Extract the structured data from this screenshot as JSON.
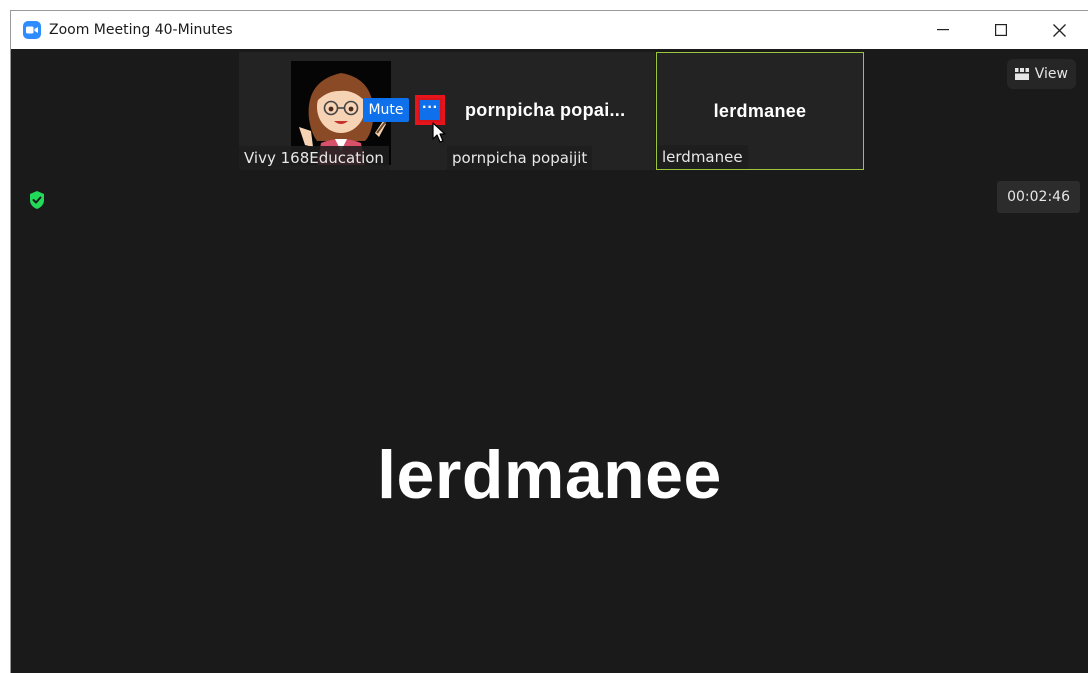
{
  "window": {
    "title": "Zoom Meeting 40-Minutes"
  },
  "participants": [
    {
      "label": "Vivy 168Education"
    },
    {
      "display_name": "pornpicha  popai...",
      "label": "pornpicha popaijit"
    },
    {
      "display_name": "lerdmanee",
      "label": "lerdmanee"
    }
  ],
  "hover_controls": {
    "mute_label": "Mute",
    "more_label": "···"
  },
  "toolbar": {
    "view_label": "View"
  },
  "meeting": {
    "timer": "00:02:46",
    "active_speaker": "lerdmanee"
  },
  "colors": {
    "accent": "#0e71eb",
    "highlight": "#e8141b",
    "active_border": "#9bc53d",
    "secure": "#23d959",
    "background": "#1a1a1a"
  },
  "icons": [
    "zoom-app-icon",
    "minimize-icon",
    "maximize-icon",
    "close-icon",
    "view-grid-icon",
    "shield-check-icon",
    "cursor-icon",
    "red-arrow-icon"
  ]
}
